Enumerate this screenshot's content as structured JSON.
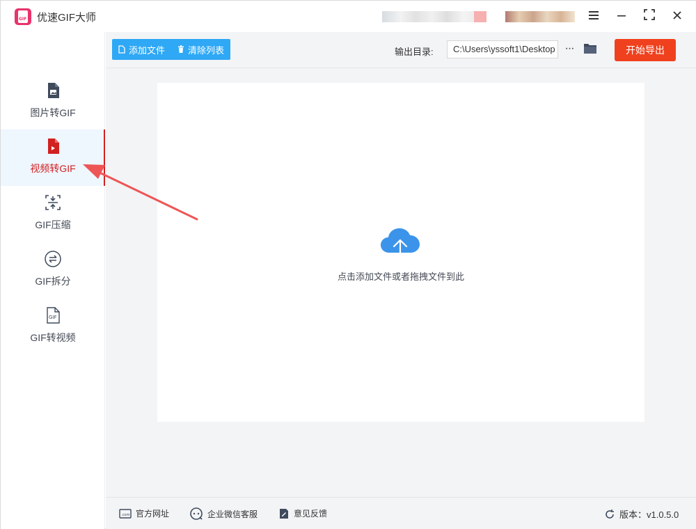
{
  "window": {
    "title": "优速GIF大师",
    "controls": [
      "menu-icon",
      "minimize-icon",
      "maximize-icon",
      "close-icon"
    ]
  },
  "sidebar": {
    "items": [
      {
        "label": "图片转GIF",
        "icon": "image-file-icon",
        "active": false
      },
      {
        "label": "视频转GIF",
        "icon": "video-file-icon",
        "active": true
      },
      {
        "label": "GIF压缩",
        "icon": "compress-icon",
        "active": false
      },
      {
        "label": "GIF拆分",
        "icon": "split-icon",
        "active": false
      },
      {
        "label": "GIF转视频",
        "icon": "gif-file-icon",
        "active": false
      }
    ]
  },
  "toolbar": {
    "add_file_label": "添加文件",
    "clear_list_label": "清除列表",
    "output_dir_label": "输出目录:",
    "output_dir_value": "C:\\Users\\yssoft1\\Desktop",
    "more_label": "···",
    "export_label": "开始导出"
  },
  "dropzone": {
    "hint": "点击添加文件或者拖拽文件到此",
    "icon": "cloud-upload-icon"
  },
  "footer": {
    "website_label": "官方网址",
    "wechat_label": "企业微信客服",
    "feedback_label": "意见反馈",
    "version_label": "版本：v1.0.5.0"
  },
  "colors": {
    "accent_blue": "#2fa8f5",
    "export_red": "#f0411e",
    "active_red": "#d12121",
    "annotation_arrow": "#ee5555"
  }
}
